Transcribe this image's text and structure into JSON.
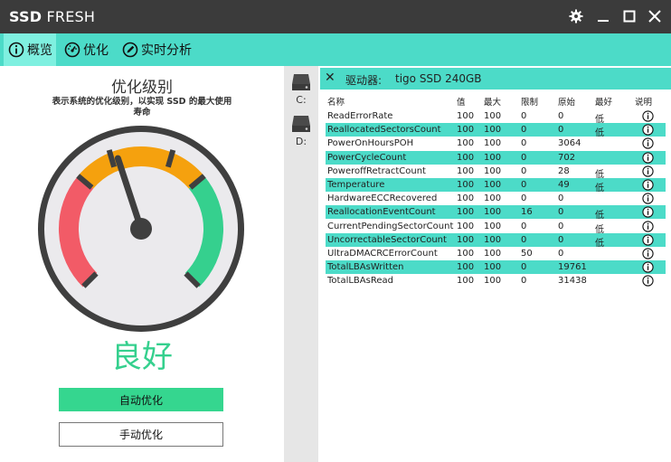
{
  "app": {
    "title_bold": "SSD",
    "title_rest": "FRESH"
  },
  "nav": {
    "tabs": [
      {
        "label": "概览",
        "icon": "info-circle-icon"
      },
      {
        "label": "优化",
        "icon": "speedometer-icon"
      },
      {
        "label": "实时分析",
        "icon": "pen-circle-icon"
      }
    ]
  },
  "overview": {
    "title": "优化级别",
    "description": "表示系统的优化级别，以实现 SSD 的最大使用寿命",
    "status": "良好",
    "auto_button": "自动优化",
    "manual_button": "手动优化"
  },
  "drives": [
    {
      "label": "C:",
      "icon": "hard-drive-icon"
    },
    {
      "label": "D:",
      "icon": "hard-drive-icon"
    }
  ],
  "drive_panel": {
    "label": "驱动器:",
    "name": "tigo SSD 240GB"
  },
  "smart_table": {
    "headers": [
      "名称",
      "值",
      "最大",
      "限制",
      "原始",
      "最好",
      "说明"
    ],
    "rows": [
      {
        "name": "ReadErrorRate",
        "value": "100",
        "max": "100",
        "limit": "0",
        "raw": "0",
        "best": "低",
        "highlight": false
      },
      {
        "name": "ReallocatedSectorsCount",
        "value": "100",
        "max": "100",
        "limit": "0",
        "raw": "0",
        "best": "低",
        "highlight": true
      },
      {
        "name": "PowerOnHoursPOH",
        "value": "100",
        "max": "100",
        "limit": "0",
        "raw": "3064",
        "best": "",
        "highlight": false
      },
      {
        "name": "PowerCycleCount",
        "value": "100",
        "max": "100",
        "limit": "0",
        "raw": "702",
        "best": "",
        "highlight": true
      },
      {
        "name": "PoweroffRetractCount",
        "value": "100",
        "max": "100",
        "limit": "0",
        "raw": "28",
        "best": "低",
        "highlight": false
      },
      {
        "name": "Temperature",
        "value": "100",
        "max": "100",
        "limit": "0",
        "raw": "49",
        "best": "低",
        "highlight": true
      },
      {
        "name": "HardwareECCRecovered",
        "value": "100",
        "max": "100",
        "limit": "0",
        "raw": "0",
        "best": "",
        "highlight": false
      },
      {
        "name": "ReallocationEventCount",
        "value": "100",
        "max": "100",
        "limit": "16",
        "raw": "0",
        "best": "低",
        "highlight": true
      },
      {
        "name": "CurrentPendingSectorCount",
        "value": "100",
        "max": "100",
        "limit": "0",
        "raw": "0",
        "best": "低",
        "highlight": false
      },
      {
        "name": "UncorrectableSectorCount",
        "value": "100",
        "max": "100",
        "limit": "0",
        "raw": "0",
        "best": "低",
        "highlight": true
      },
      {
        "name": "UltraDMACRCErrorCount",
        "value": "100",
        "max": "100",
        "limit": "50",
        "raw": "0",
        "best": "",
        "highlight": false
      },
      {
        "name": "TotalLBAsWritten",
        "value": "100",
        "max": "100",
        "limit": "0",
        "raw": "19761",
        "best": "",
        "highlight": true
      },
      {
        "name": "TotalLBAsRead",
        "value": "100",
        "max": "100",
        "limit": "0",
        "raw": "31438",
        "best": "",
        "highlight": false
      }
    ]
  },
  "colors": {
    "titlebar": "#3b3b3b",
    "accent": "#4cdbc8",
    "good": "#35d08e",
    "gauge_red": "#f25b67",
    "gauge_orange": "#f5a10e",
    "gauge_green": "#35d08e"
  }
}
